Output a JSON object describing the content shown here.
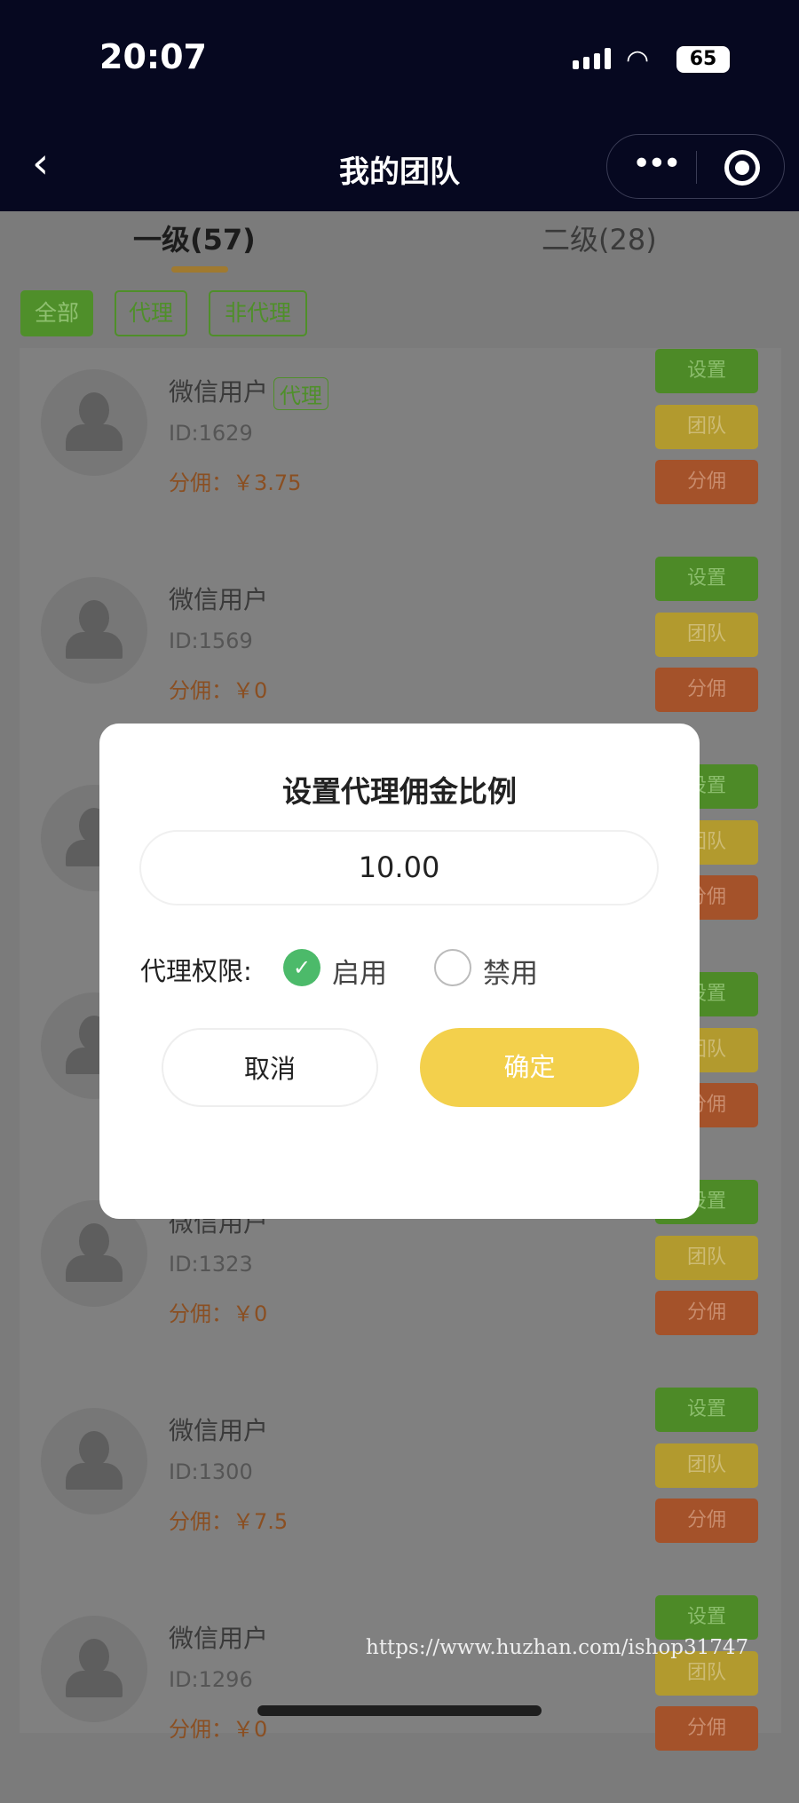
{
  "status_bar": {
    "time": "20:07",
    "battery": "65"
  },
  "nav": {
    "back": "‹",
    "title": "我的团队",
    "more": "•••"
  },
  "tabs": [
    {
      "label": "一级(57)",
      "active": true
    },
    {
      "label": "二级(28)",
      "active": false
    }
  ],
  "filters": [
    {
      "label": "全部",
      "active": true
    },
    {
      "label": "代理",
      "active": false
    },
    {
      "label": "非代理",
      "active": false
    }
  ],
  "members": [
    {
      "name": "微信用户",
      "tag": "代理",
      "id": "ID:1629",
      "commission": "分佣：￥3.75"
    },
    {
      "name": "微信用户",
      "tag": "",
      "id": "ID:1569",
      "commission": "分佣：￥0"
    },
    {
      "name": "",
      "tag": "",
      "id": "",
      "commission": ""
    },
    {
      "name": "",
      "tag": "",
      "id": "",
      "commission": ""
    },
    {
      "name": "微信用户",
      "tag": "",
      "id": "ID:1323",
      "commission": "分佣：￥0"
    },
    {
      "name": "微信用户",
      "tag": "",
      "id": "ID:1300",
      "commission": "分佣：￥7.5"
    },
    {
      "name": "微信用户",
      "tag": "",
      "id": "ID:1296",
      "commission": "分佣：￥0"
    }
  ],
  "row_buttons": {
    "settings": "设置",
    "team": "团队",
    "commission": "分佣"
  },
  "modal": {
    "title": "设置代理佣金比例",
    "rate_value": "10.00",
    "permission_label": "代理权限:",
    "enable": "启用",
    "disable": "禁用",
    "selected": "启用",
    "cancel": "取消",
    "confirm": "确定"
  },
  "watermark": "https://www.huzhan.com/ishop31747",
  "colors": {
    "nav_bg": "#060820",
    "confirm": "#f3d04c",
    "radio_checked": "#4cba6a",
    "settings_btn": "#4d8a27",
    "team_btn": "#b29a2e",
    "commission_btn": "#a4522a"
  }
}
